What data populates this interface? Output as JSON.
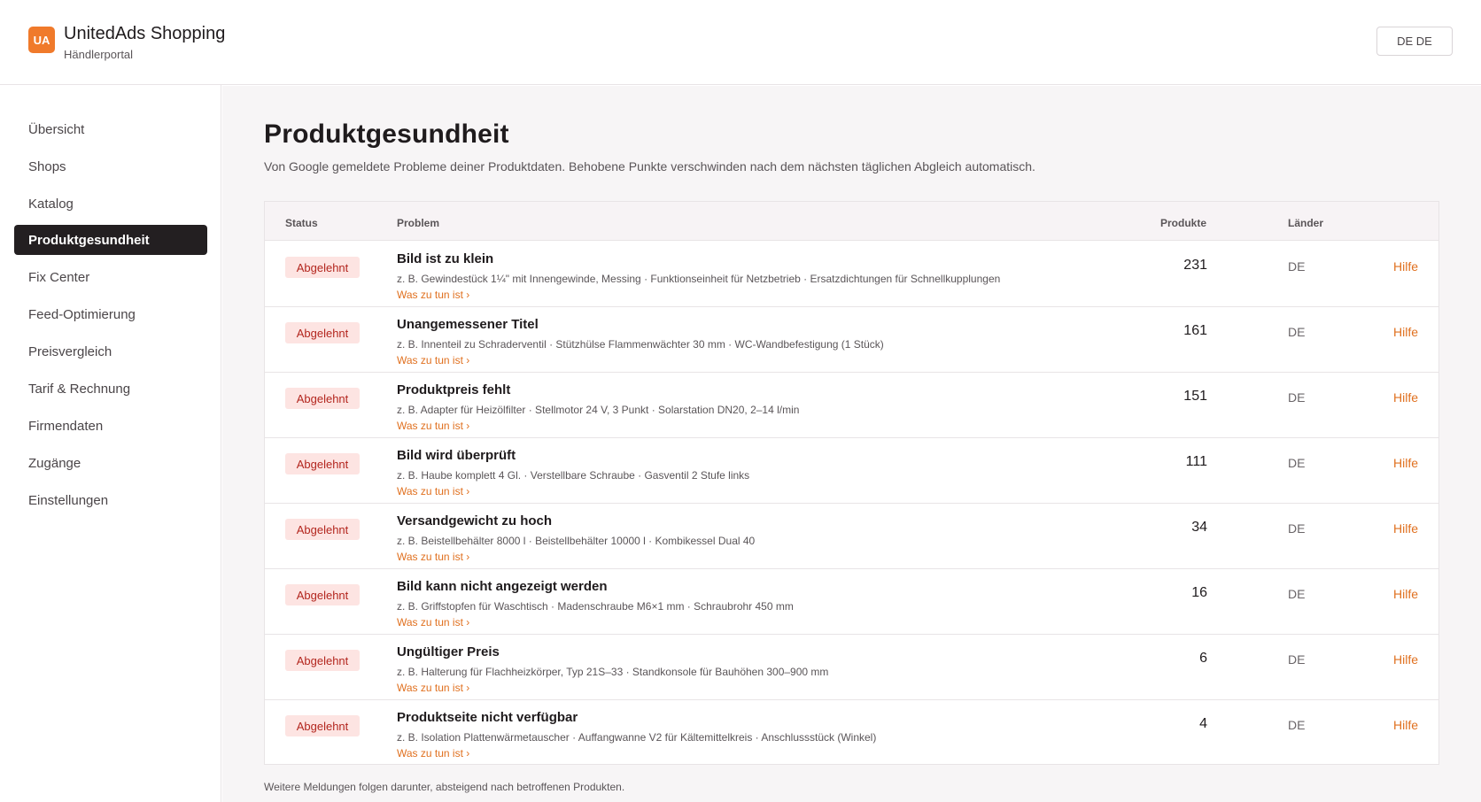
{
  "header": {
    "logo_text": "UA",
    "brand_title": "UnitedAds Shopping",
    "brand_subtitle": "Händlerportal",
    "lang_button": "DE DE"
  },
  "sidebar": {
    "items": [
      {
        "label": "Übersicht",
        "active": false
      },
      {
        "label": "Shops",
        "active": false
      },
      {
        "label": "Katalog",
        "active": false
      },
      {
        "label": "Produktgesundheit",
        "active": true
      },
      {
        "label": "Fix Center",
        "active": false
      },
      {
        "label": "Feed-Optimierung",
        "active": false
      },
      {
        "label": "Preisvergleich",
        "active": false
      },
      {
        "label": "Tarif & Rechnung",
        "active": false
      },
      {
        "label": "Firmendaten",
        "active": false
      },
      {
        "label": "Zugänge",
        "active": false
      },
      {
        "label": "Einstellungen",
        "active": false
      }
    ]
  },
  "main": {
    "title": "Produktgesundheit",
    "description": "Von Google gemeldete Probleme deiner Produktdaten. Behobene Punkte verschwinden nach dem nächsten täglichen Abgleich automatisch.",
    "columns": {
      "status": "Status",
      "problem": "Problem",
      "products": "Produkte",
      "countries": "Länder"
    },
    "rows": [
      {
        "status": "Abgelehnt",
        "title": "Bild ist zu klein",
        "examples": "z. B. Gewindestück 1¼\" mit Innengewinde, Messing · Funktionseinheit für Netzbetrieb · Ersatzdichtungen für Schnellkupplungen",
        "link": "Was zu tun ist ›",
        "count": "231",
        "country": "DE",
        "help": "Hilfe"
      },
      {
        "status": "Abgelehnt",
        "title": "Unangemessener Titel",
        "examples": "z. B. Innenteil zu Schraderventil · Stützhülse Flammenwächter 30 mm · WC-Wandbefestigung (1 Stück)",
        "link": "Was zu tun ist ›",
        "count": "161",
        "country": "DE",
        "help": "Hilfe"
      },
      {
        "status": "Abgelehnt",
        "title": "Produktpreis fehlt",
        "examples": "z. B. Adapter für Heizölfilter · Stellmotor 24 V, 3 Punkt · Solarstation DN20, 2–14 l/min",
        "link": "Was zu tun ist ›",
        "count": "151",
        "country": "DE",
        "help": "Hilfe"
      },
      {
        "status": "Abgelehnt",
        "title": "Bild wird überprüft",
        "examples": "z. B. Haube komplett 4 Gl. · Verstellbare Schraube · Gasventil 2 Stufe links",
        "link": "Was zu tun ist ›",
        "count": "111",
        "country": "DE",
        "help": "Hilfe"
      },
      {
        "status": "Abgelehnt",
        "title": "Versandgewicht zu hoch",
        "examples": "z. B. Beistellbehälter 8000 l · Beistellbehälter 10000 l · Kombikessel Dual 40",
        "link": "Was zu tun ist ›",
        "count": "34",
        "country": "DE",
        "help": "Hilfe"
      },
      {
        "status": "Abgelehnt",
        "title": "Bild kann nicht angezeigt werden",
        "examples": "z. B. Griffstopfen für Waschtisch · Madenschraube M6×1 mm · Schraubrohr 450 mm",
        "link": "Was zu tun ist ›",
        "count": "16",
        "country": "DE",
        "help": "Hilfe"
      },
      {
        "status": "Abgelehnt",
        "title": "Ungültiger Preis",
        "examples": "z. B. Halterung für Flachheizkörper, Typ 21S–33 · Standkonsole für Bauhöhen 300–900 mm",
        "link": "Was zu tun ist ›",
        "count": "6",
        "country": "DE",
        "help": "Hilfe"
      },
      {
        "status": "Abgelehnt",
        "title": "Produktseite nicht verfügbar",
        "examples": "z. B. Isolation Plattenwärmetauscher · Auffangwanne V2 für Kältemittelkreis · Anschlussstück (Winkel)",
        "link": "Was zu tun ist ›",
        "count": "4",
        "country": "DE",
        "help": "Hilfe"
      }
    ],
    "footer_note": "Weitere Meldungen folgen darunter, absteigend nach betroffenen Produkten."
  }
}
